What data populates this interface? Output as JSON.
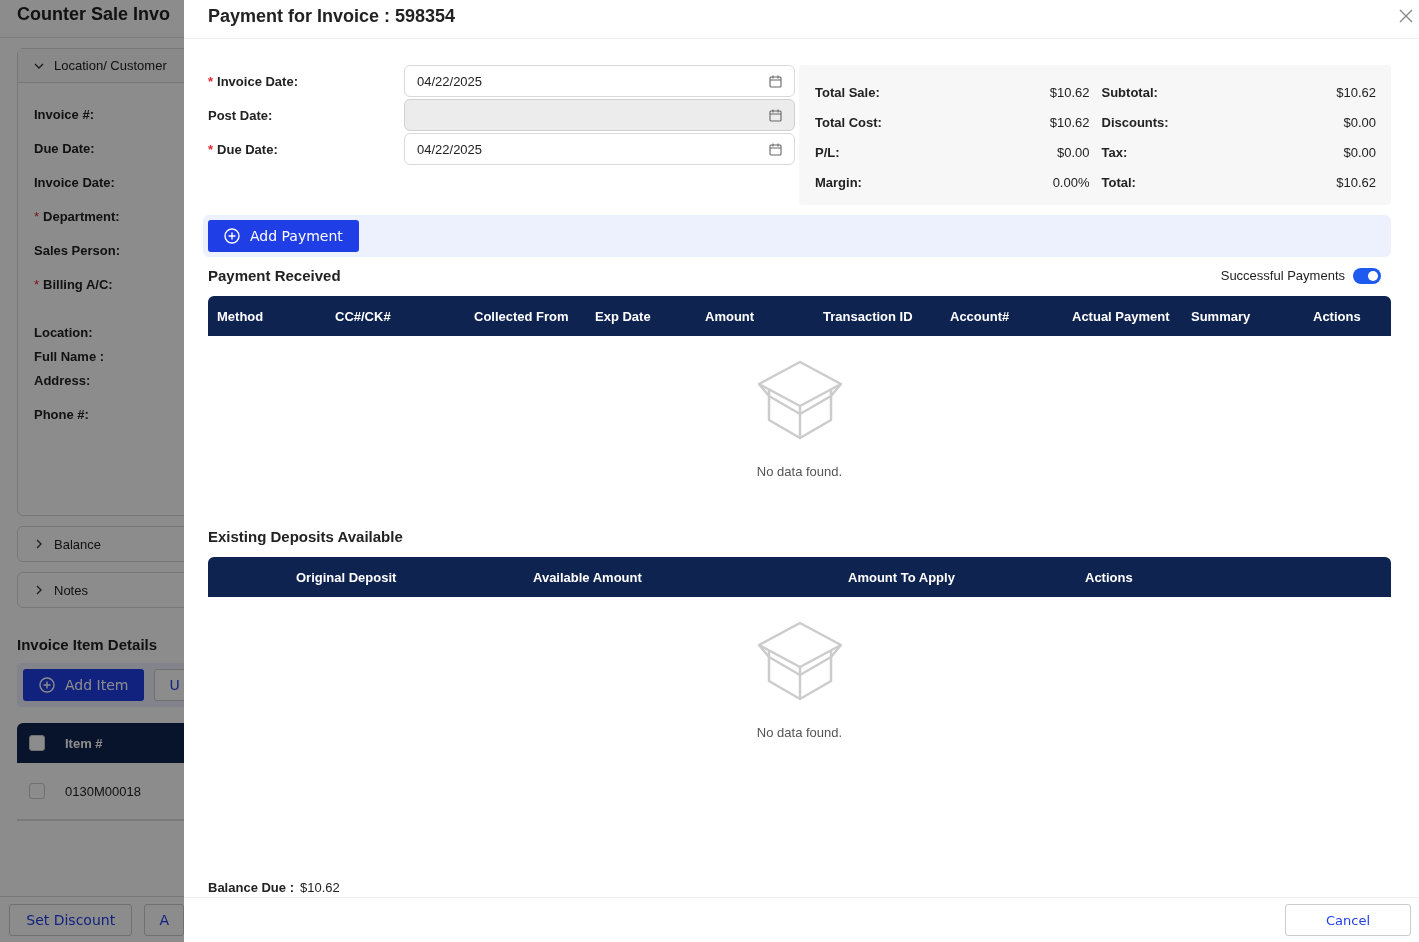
{
  "background_page": {
    "title": "Counter Sale Invo",
    "location_panel": {
      "label": "Location/ Customer",
      "expanded": true,
      "fields": [
        {
          "label": "Invoice #:"
        },
        {
          "label": "Due Date:"
        },
        {
          "label": "Invoice Date:"
        },
        {
          "label": "Department:",
          "required_mark": "*"
        },
        {
          "label": "Sales Person:"
        },
        {
          "label": "Billing A/C:",
          "required_mark": "*"
        }
      ],
      "location_fields": [
        "Location:",
        "Full Name :",
        "Address:",
        "Phone #:"
      ]
    },
    "panels": [
      {
        "label": "Balance",
        "expanded": false
      },
      {
        "label": "Notes",
        "expanded": false
      }
    ],
    "item_details": {
      "title": "Invoice Item Details",
      "add_button": "Add Item",
      "cut_button": "U",
      "header": {
        "label": "Item #",
        "checked": false
      },
      "rows": [
        {
          "item": "0130M00018",
          "checked": false
        }
      ]
    },
    "footer_buttons": [
      "Set Discount",
      "A"
    ]
  },
  "dialog": {
    "title": "Payment for Invoice : 598354",
    "date_fields": [
      {
        "label": "Invoice Date:",
        "required_mark": "*",
        "value": "04/22/2025",
        "disabled": false
      },
      {
        "label": "Post Date:",
        "disabled": true
      },
      {
        "label": "Due Date:",
        "required_mark": "*",
        "value": "04/22/2025",
        "disabled": false
      }
    ],
    "summary": [
      {
        "label": "Total Sale:",
        "value": "$10.62"
      },
      {
        "label": "Subtotal:",
        "value": "$10.62"
      },
      {
        "label": "Total Cost:",
        "value": "$10.62"
      },
      {
        "label": "Discounts:",
        "value": "$0.00"
      },
      {
        "label": "P/L:",
        "value": "$0.00"
      },
      {
        "label": "Tax:",
        "value": "$0.00"
      },
      {
        "label": "Margin:",
        "value": "0.00%"
      },
      {
        "label": "Total:",
        "value": "$10.62"
      }
    ],
    "add_payment_button": "Add Payment",
    "payment_received": {
      "title": "Payment Received",
      "toggle": {
        "label": "Successful Payments",
        "on": true
      },
      "columns": [
        "Method",
        "CC#/CK#",
        "Collected From",
        "Exp Date",
        "Amount",
        "Transaction ID",
        "Account#",
        "Actual Payment",
        "Summary",
        "Actions"
      ],
      "empty_text": "No data found."
    },
    "deposits": {
      "title": "Existing Deposits Available",
      "columns": [
        "Original Deposit",
        "Available Amount",
        "Amount To Apply",
        "Actions"
      ],
      "empty_text": "No data found."
    },
    "balance_due": {
      "label": "Balance Due :",
      "value": "$10.62"
    },
    "cancel_button": "Cancel"
  }
}
